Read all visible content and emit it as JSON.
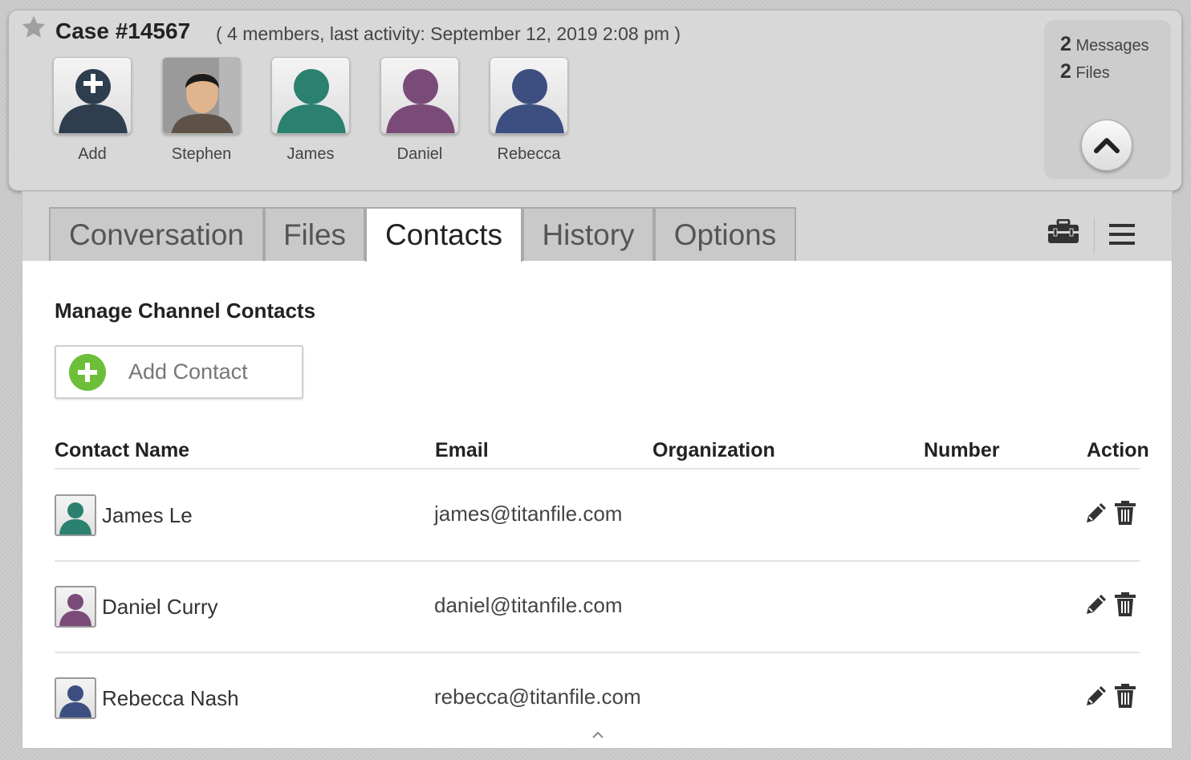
{
  "header": {
    "case_title": "Case #14567",
    "case_meta": "( 4 members, last activity: September 12, 2019 2:08 pm )",
    "members": [
      {
        "name": "Add",
        "color": "#2e3e4e",
        "type": "add"
      },
      {
        "name": "Stephen",
        "color": "#6b5a4a",
        "type": "photo"
      },
      {
        "name": "James",
        "color": "#2b8070",
        "type": "silhouette"
      },
      {
        "name": "Daniel",
        "color": "#7a4b78",
        "type": "silhouette"
      },
      {
        "name": "Rebecca",
        "color": "#3d4f80",
        "type": "silhouette"
      }
    ],
    "stats": {
      "messages_count": "2",
      "messages_label": "Messages",
      "files_count": "2",
      "files_label": "Files"
    }
  },
  "tabs": [
    {
      "label": "Conversation",
      "active": false
    },
    {
      "label": "Files",
      "active": false
    },
    {
      "label": "Contacts",
      "active": true
    },
    {
      "label": "History",
      "active": false
    },
    {
      "label": "Options",
      "active": false
    }
  ],
  "contacts": {
    "section_title": "Manage Channel Contacts",
    "add_label": "Add Contact",
    "columns": [
      "Contact Name",
      "Email",
      "Organization",
      "Number",
      "Action"
    ],
    "rows": [
      {
        "name": "James Le",
        "email": "james@titanfile.com",
        "organization": "",
        "number": "",
        "color": "#2b8070"
      },
      {
        "name": "Daniel Curry",
        "email": "daniel@titanfile.com",
        "organization": "",
        "number": "",
        "color": "#7a4b78"
      },
      {
        "name": "Rebecca Nash",
        "email": "rebecca@titanfile.com",
        "organization": "",
        "number": "",
        "color": "#3d4f80"
      }
    ]
  },
  "colors": {
    "accent_green": "#6dbf3a",
    "icon_dark": "#333333"
  }
}
